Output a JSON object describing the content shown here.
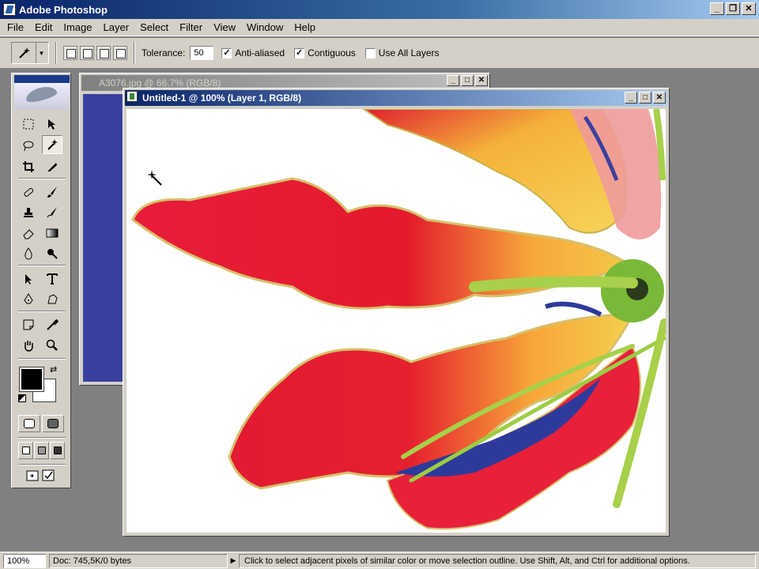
{
  "window": {
    "title": "Adobe Photoshop",
    "minimize_glyph": "_",
    "restore_glyph": "❐",
    "close_glyph": "✕"
  },
  "menu": [
    "File",
    "Edit",
    "Image",
    "Layer",
    "Select",
    "Filter",
    "View",
    "Window",
    "Help"
  ],
  "options_bar": {
    "tool_icon": "magic-wand-icon",
    "tolerance_label": "Tolerance:",
    "tolerance_value": "50",
    "anti_aliased_label": "Anti-aliased",
    "anti_aliased_checked": true,
    "contiguous_label": "Contiguous",
    "contiguous_checked": true,
    "use_all_layers_label": "Use All Layers",
    "use_all_layers_checked": false,
    "check_glyph": "✓"
  },
  "toolbox": {
    "active_tool": "magic-wand",
    "foreground_color": "#000000",
    "background_color": "#ffffff"
  },
  "documents": {
    "back_title": "A3076.jpg @ 66.7% (RGB/8)",
    "front_title": "Untitled-1 @ 100% (Layer 1, RGB/8)"
  },
  "status_bar": {
    "zoom": "100%",
    "doc_info": "Doc: 745,5K/0 bytes",
    "message": "Click to select adjacent pixels of similar color or move selection outline.  Use Shift, Alt, and Ctrl for additional options."
  },
  "colors": {
    "petal_red": "#e8192c",
    "petal_yellow": "#f5b52a",
    "stem_green": "#a8d04a",
    "back_canvas_blue": "#3a40a0"
  }
}
